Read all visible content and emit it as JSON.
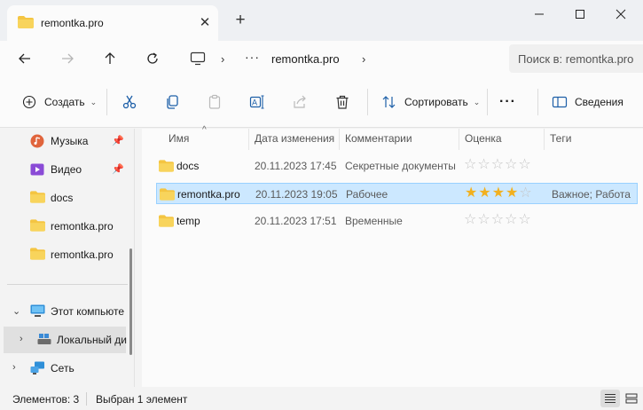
{
  "window": {
    "tab_title": "remontka.pro",
    "new_tab": "+",
    "close_tab": "✕"
  },
  "address": {
    "breadcrumb": "remontka.pro",
    "dots": "···",
    "search_placeholder": "Поиск в: remontka.pro"
  },
  "toolbar": {
    "create_label": "Создать",
    "sort_label": "Сортировать",
    "more": "···",
    "details_label": "Сведения"
  },
  "sidebar": {
    "items": [
      {
        "label": "Музыка",
        "icon": "music-icon"
      },
      {
        "label": "Видео",
        "icon": "video-icon"
      },
      {
        "label": "docs",
        "icon": "folder-icon"
      },
      {
        "label": "remontka.pro",
        "icon": "folder-icon"
      },
      {
        "label": "remontka.pro",
        "icon": "folder-icon"
      },
      {
        "label": "Этот компьюте",
        "icon": "computer-icon"
      },
      {
        "label": "Локальный ди",
        "icon": "drive-icon"
      },
      {
        "label": "Сеть",
        "icon": "network-icon"
      }
    ]
  },
  "columns": {
    "name": "Имя",
    "date": "Дата изменения",
    "comment": "Комментарии",
    "rating": "Оценка",
    "tags": "Теги"
  },
  "files": [
    {
      "name": "docs",
      "date": "20.11.2023 17:45",
      "comment": "Секретные документы",
      "rating": 0,
      "tags": ""
    },
    {
      "name": "remontka.pro",
      "date": "20.11.2023 19:05",
      "comment": "Рабочее",
      "rating": 4,
      "tags": "Важное; Работа"
    },
    {
      "name": "temp",
      "date": "20.11.2023 17:51",
      "comment": "Временные",
      "rating": 0,
      "tags": ""
    }
  ],
  "status": {
    "count": "Элементов: 3",
    "selected": "Выбран 1 элемент"
  },
  "colors": {
    "folder": "#f4c542",
    "selection": "#cce8ff",
    "star": "#f2b01e"
  }
}
